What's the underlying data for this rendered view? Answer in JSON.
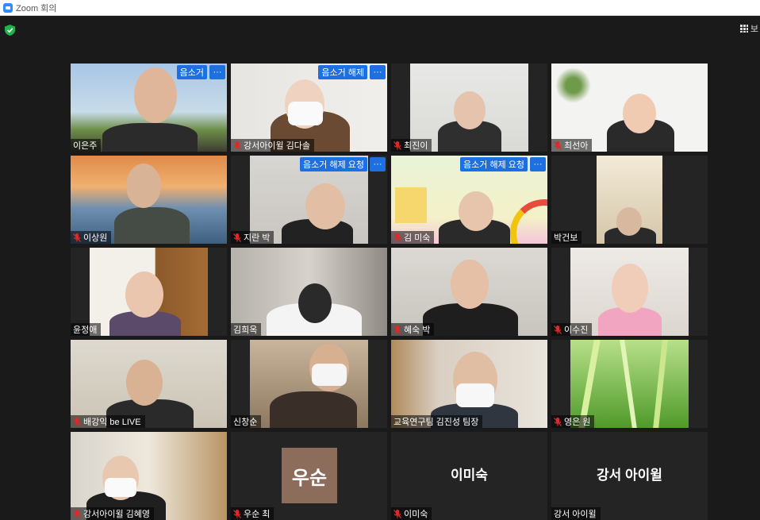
{
  "window": {
    "title": "Zoom 회의"
  },
  "toolbar": {
    "view_label": "보"
  },
  "overlay": {
    "more": "···"
  },
  "participants": [
    {
      "name": "이은주",
      "muted": false,
      "badge": "음소거",
      "has_video": true
    },
    {
      "name": "강서아이윌 김다솔",
      "muted": true,
      "badge": "음소거 해제",
      "has_video": true
    },
    {
      "name": "최진이",
      "muted": true,
      "badge": "",
      "has_video": true
    },
    {
      "name": "최선아",
      "muted": true,
      "badge": "",
      "has_video": true
    },
    {
      "name": "이상원",
      "muted": true,
      "badge": "",
      "has_video": true
    },
    {
      "name": "지란 박",
      "muted": true,
      "badge": "음소거 해제 요청",
      "has_video": true
    },
    {
      "name": "김 미숙",
      "muted": true,
      "badge": "음소거 해제 요청",
      "has_video": true
    },
    {
      "name": "박건보",
      "muted": false,
      "badge": "",
      "has_video": true
    },
    {
      "name": "윤정애",
      "muted": false,
      "badge": "",
      "has_video": true
    },
    {
      "name": "김희옥",
      "muted": false,
      "badge": "",
      "has_video": true
    },
    {
      "name": "혜숙 박",
      "muted": true,
      "badge": "",
      "has_video": true
    },
    {
      "name": "이수진",
      "muted": true,
      "badge": "",
      "has_video": true
    },
    {
      "name": "배강익 be LIVE",
      "muted": true,
      "badge": "",
      "has_video": true
    },
    {
      "name": "신창순",
      "muted": false,
      "badge": "",
      "has_video": true
    },
    {
      "name": "교육연구팀 김진성 팀장",
      "muted": false,
      "badge": "",
      "has_video": true,
      "active_speaker": true
    },
    {
      "name": "영은 원",
      "muted": true,
      "badge": "",
      "has_video": true
    },
    {
      "name": "강서아이윌 김혜영",
      "muted": true,
      "badge": "",
      "has_video": true
    },
    {
      "name": "우순 최",
      "muted": true,
      "badge": "",
      "has_video": false,
      "avatar_text": "우순"
    },
    {
      "name": "이미숙",
      "muted": true,
      "badge": "",
      "has_video": false,
      "display_text": "이미숙"
    },
    {
      "name": "강서 아이윌",
      "muted": false,
      "badge": "",
      "has_video": false,
      "display_text": "강서 아이윌"
    }
  ],
  "colors": {
    "background": "#1a1a1a",
    "tile": "#242424",
    "button_blue": "#1e6fe0",
    "active_speaker": "#d7e66b",
    "muted_red": "#e02828",
    "security_green": "#23b14d"
  }
}
